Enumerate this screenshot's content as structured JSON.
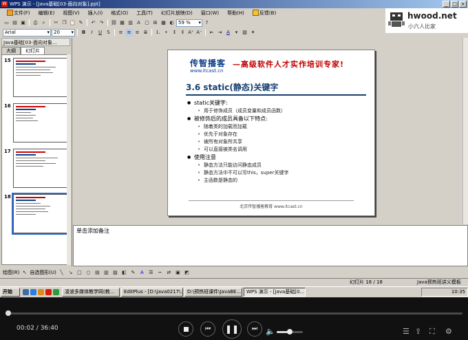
{
  "window": {
    "app_icon": "W",
    "title": "WPS 演示 - [Java基础[03-面向对象].ppt]",
    "controls": [
      "_",
      "□",
      "×"
    ]
  },
  "menu": {
    "items": [
      "文件(F)",
      "编辑(E)",
      "视图(V)",
      "插入(I)",
      "格式(O)",
      "工具(T)",
      "幻灯片放映(D)",
      "窗口(W)",
      "帮助(H)",
      "反馈(B)"
    ]
  },
  "toolbar": {
    "font": "Arial",
    "font_size": "20",
    "zoom": "59 %",
    "bold": "B",
    "italic": "I",
    "underline": "U",
    "shadow": "S",
    "font_color": "A"
  },
  "logo": {
    "text": "hwood.net",
    "subtext": "小六人比家"
  },
  "left_panel": {
    "doc_tab": "Java基础[03-面向对象...",
    "tabs": [
      "大纲",
      "幻灯片"
    ],
    "slides": [
      {
        "num": "15"
      },
      {
        "num": "16"
      },
      {
        "num": "17"
      },
      {
        "num": "18",
        "selected": true
      }
    ]
  },
  "slide": {
    "brand": "传智播客",
    "brand_url": "www.itcast.cn",
    "tagline": "—高级软件人才实作培训专家!",
    "title": "3.6 static(静态)关键字",
    "bullets": [
      {
        "text": "static关键字:",
        "subs": [
          "用于修饰成员（成员变量和成员函数）"
        ]
      },
      {
        "text": "被修饰后的成员具备以下特点:",
        "subs": [
          "随着类的加载而加载",
          "优先于对象存在",
          "被所有对象所共享",
          "可以直接被类名调用"
        ]
      },
      {
        "text": "使用注意",
        "subs": [
          "静态方法只能访问静态成员",
          "静态方法中不可以写this，super关键字",
          "主函数是静态的"
        ]
      }
    ],
    "footer": "北京传智播客教育 www.itcast.cn"
  },
  "notes": {
    "placeholder": "单击添加备注"
  },
  "drawbar": {
    "draw_label": "绘图(R)",
    "autoshape_label": "自选图形(U)"
  },
  "status": {
    "slide_counter": "幻灯片 18 / 18",
    "theme": "Java预热班讲义模板"
  },
  "taskbar": {
    "start": "开始",
    "tasks": [
      {
        "label": "凌波多媒体教学网(教...",
        "active": false
      },
      {
        "label": "EditPlus - [D:\\java0217\\...",
        "active": false
      },
      {
        "label": "D:\\预热班课件\\JavaBE...",
        "active": false
      },
      {
        "label": "WPS 演示 - [Java基础[0...",
        "active": true
      }
    ],
    "clock": "10:35"
  },
  "player": {
    "current_time": "00:02",
    "total_time": "36:40",
    "time_separator": " / ",
    "progress": 0.001,
    "volume": 0.5
  },
  "colors": {
    "title_bar": "#0a246a",
    "slide_title": "#16406e",
    "tagline": "#c00000",
    "brand": "#0a3c8a"
  }
}
